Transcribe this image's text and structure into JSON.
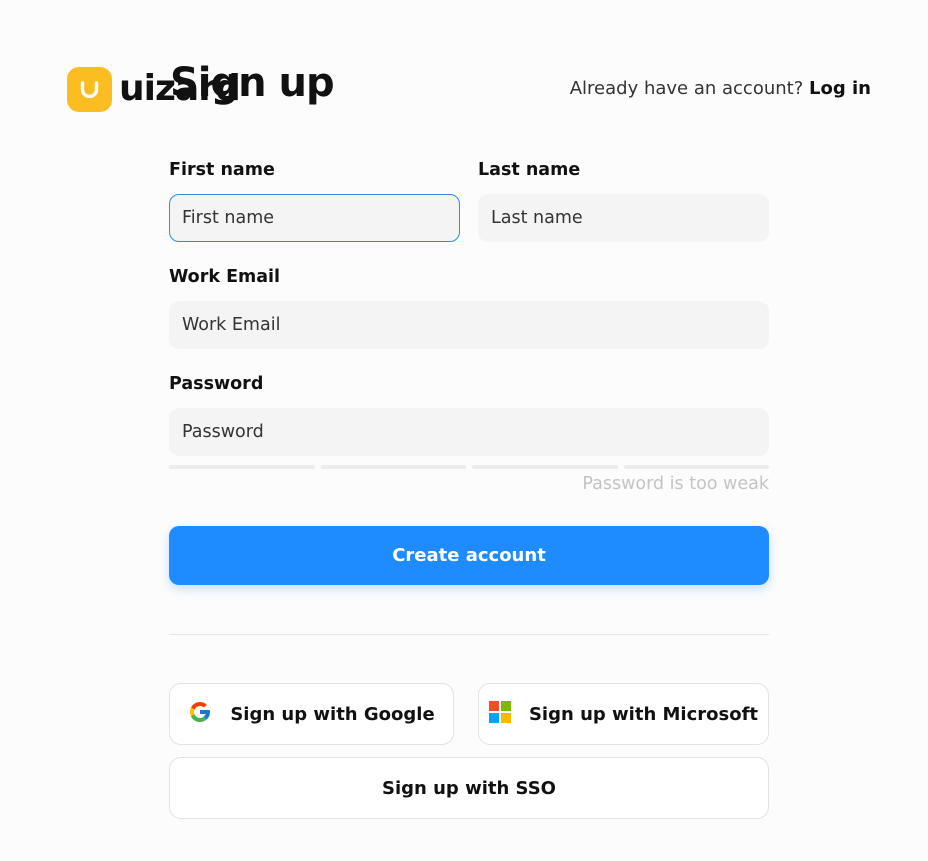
{
  "header": {
    "logo_text": "uizard",
    "title": "Sign up",
    "login_prompt": "Already have an account?",
    "login_link": "Log in"
  },
  "form": {
    "first_name": {
      "label": "First name",
      "placeholder": "First name",
      "value": ""
    },
    "last_name": {
      "label": "Last name",
      "placeholder": "Last name",
      "value": ""
    },
    "work_email": {
      "label": "Work Email",
      "placeholder": "Work Email",
      "value": ""
    },
    "password": {
      "label": "Password",
      "placeholder": "Password",
      "value": ""
    },
    "password_strength": {
      "text": "Password is too weak",
      "filled_segments": 0,
      "total_segments": 4
    },
    "submit_label": "Create account"
  },
  "social": {
    "google_label": "Sign up with Google",
    "google_icon": "google-icon",
    "microsoft_label": "Sign up with Microsoft",
    "microsoft_icon": "microsoft-icon",
    "sso_label": "Sign up with SSO"
  },
  "colors": {
    "accent": "#1e8cff",
    "logo": "#fcbd23",
    "focus_border": "#2b8ce6",
    "input_bg": "#f4f4f4",
    "weak_text": "#c4c4c4"
  }
}
